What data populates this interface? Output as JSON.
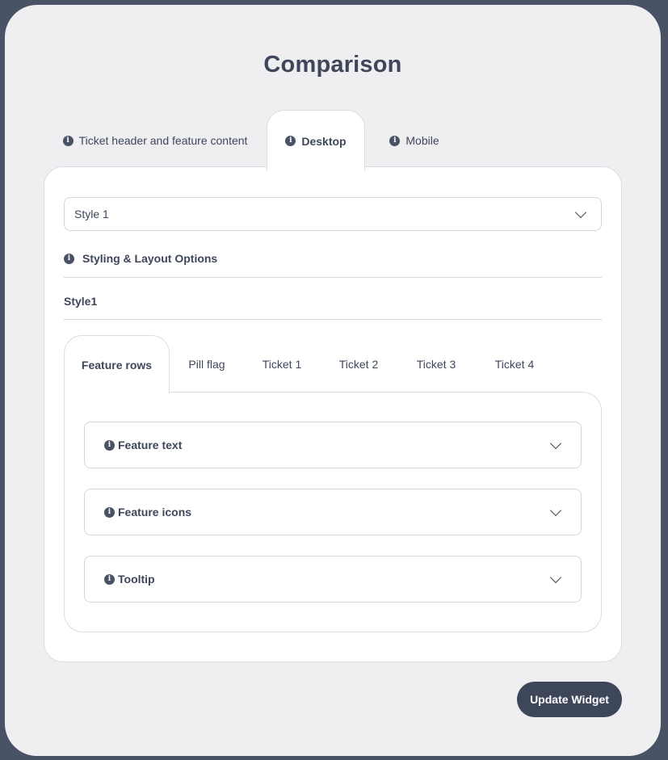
{
  "modal": {
    "title": "Comparison",
    "top_tabs": [
      {
        "label": "Ticket header and feature content",
        "active": false
      },
      {
        "label": "Desktop",
        "active": true
      },
      {
        "label": "Mobile",
        "active": false
      }
    ],
    "style_select": {
      "value": "Style 1"
    },
    "styling_section_label": "Styling & Layout Options",
    "style_name": "Style1",
    "inner_tabs": [
      {
        "label": "Feature rows",
        "active": true
      },
      {
        "label": "Pill flag",
        "active": false
      },
      {
        "label": "Ticket 1",
        "active": false
      },
      {
        "label": "Ticket 2",
        "active": false
      },
      {
        "label": "Ticket 3",
        "active": false
      },
      {
        "label": "Ticket 4",
        "active": false
      }
    ],
    "accordions": [
      {
        "label": "Feature text"
      },
      {
        "label": "Feature icons"
      },
      {
        "label": "Tooltip"
      }
    ],
    "update_button": "Update Widget"
  },
  "icons": {
    "info": "info-icon",
    "chevron": "chevron-down-icon"
  },
  "colors": {
    "primary": "#3e465a",
    "modal_bg": "#efeff2",
    "panel_bg": "#ffffff",
    "border": "#dcdde3"
  }
}
